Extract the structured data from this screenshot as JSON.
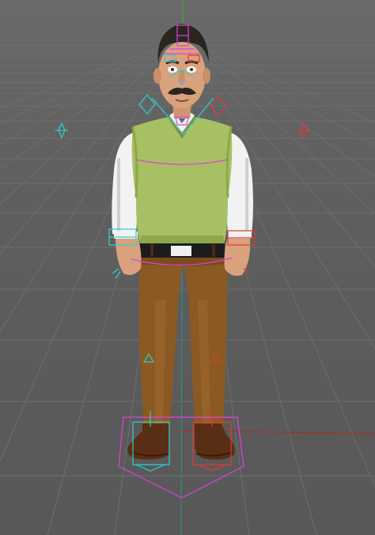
{
  "viewport": {
    "background": "#5e5e5e",
    "grid_color": "#6c6c6c",
    "axis_x_color": "#c03030",
    "axis_z_color": "#2e8f8f",
    "axis_y_color": "#3fae3f"
  },
  "character": {
    "vest_color": "#a7c063",
    "shirt_color": "#f2f2f2",
    "pants_color": "#8a5a22",
    "skin_color": "#d9a27c",
    "hair_color": "#2b2520",
    "shoe_color": "#5a2e14"
  },
  "rig": {
    "left_controls_color": "#2fd0d0",
    "right_controls_color": "#e03a3a",
    "center_controls_color": "#e040e0"
  }
}
